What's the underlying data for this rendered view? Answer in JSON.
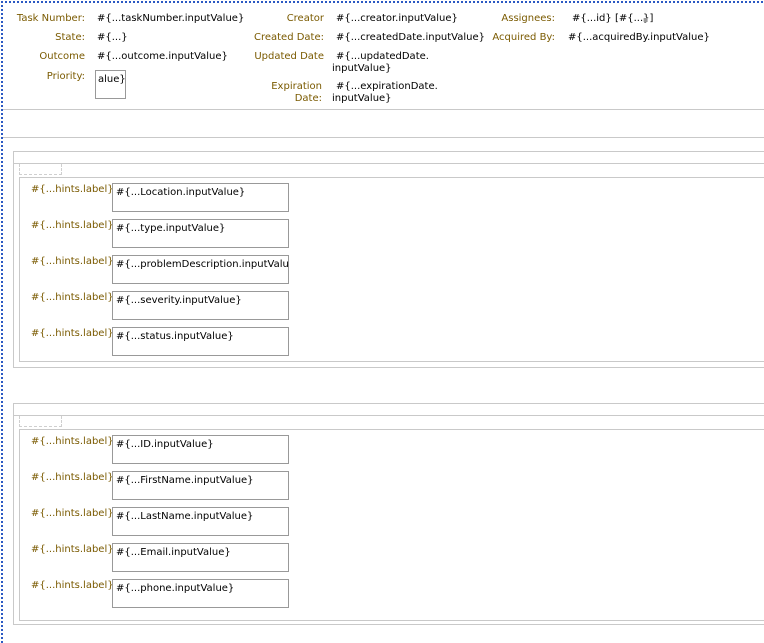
{
  "header": {
    "task_number": {
      "label": "Task Number:",
      "value": "#{...taskNumber.inputValue}"
    },
    "state": {
      "label": "State:",
      "value": "#{...}"
    },
    "outcome": {
      "label": "Outcome",
      "value": "#{...outcome.inputValue}"
    },
    "priority": {
      "label": "Priority:",
      "value": "alue}"
    },
    "creator": {
      "label": "Creator",
      "value": "#{...creator.inputValue}"
    },
    "created_date": {
      "label": "Created Date:",
      "value": "#{...createdDate.inputValue}"
    },
    "updated_date": {
      "label": "Updated Date",
      "value_line1": "#{...updatedDate.",
      "value_line2": "inputValue}"
    },
    "expiration_date": {
      "label_line1": "Expiration",
      "label_line2": "Date:",
      "value_line1": "#{...expirationDate.",
      "value_line2": "inputValue}"
    },
    "assignees": {
      "label": "Assignees:",
      "value": "#{...id} [#{...}]"
    },
    "acquired_by": {
      "label": "Acquired By:",
      "value": "#{...acquiredBy.inputValue}"
    }
  },
  "section1": {
    "fields": [
      {
        "hint": "#{...hints.label}",
        "value": "#{...Location.inputValue}"
      },
      {
        "hint": "#{...hints.label}",
        "value": "#{...type.inputValue}"
      },
      {
        "hint": "#{...hints.label}",
        "value": "#{...problemDescription.inputValue}"
      },
      {
        "hint": "#{...hints.label}",
        "value": "#{...severity.inputValue}"
      },
      {
        "hint": "#{...hints.label}",
        "value": "#{...status.inputValue}"
      }
    ]
  },
  "section2": {
    "fields": [
      {
        "hint": "#{...hints.label}",
        "value": "#{...ID.inputValue}"
      },
      {
        "hint": "#{...hints.label}",
        "value": "#{...FirstName.inputValue}"
      },
      {
        "hint": "#{...hints.label}",
        "value": "#{...LastName.inputValue}"
      },
      {
        "hint": "#{...hints.label}",
        "value": "#{...Email.inputValue}"
      },
      {
        "hint": "#{...hints.label}",
        "value": "#{...phone.inputValue}"
      }
    ]
  },
  "colors": {
    "label": "#7a5a00",
    "border": "#c9c9c9",
    "selection": "#2b59c3"
  }
}
